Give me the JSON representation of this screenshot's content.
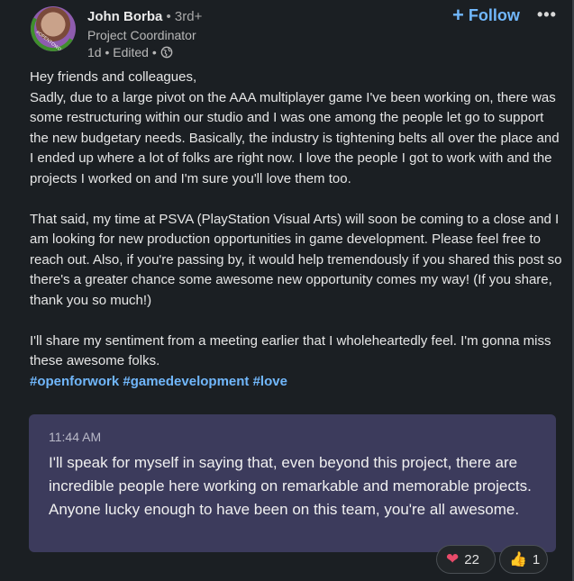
{
  "author": {
    "name": "John Borba",
    "degree": "• 3rd+",
    "headline": "Project Coordinator",
    "meta": "1d • Edited •",
    "avatar_badge": "#OPENTOWORK"
  },
  "actions": {
    "follow_label": "Follow",
    "more_icon": "•••"
  },
  "post": {
    "paragraph1": "Hey friends and colleagues,\nSadly, due to a large pivot on the AAA multiplayer game I've been working on, there was some restructuring within our studio and I was one among the people let go to support the new budgetary needs. Basically, the industry is tightening belts all over the place and I ended up where a lot of folks are right now. I love the people I got to work with and the projects I worked on and I'm sure you'll love them too.",
    "paragraph2": "That said, my time at PSVA (PlayStation Visual Arts) will soon be coming to a close and I am looking for new production opportunities in game development. Please feel free to reach out. Also, if you're passing by, it would help tremendously if you shared this post so there's a greater chance some awesome new opportunity comes my way! (If you share, thank you so much!)",
    "paragraph3": "I'll share my sentiment from a meeting earlier that I wholeheartedly feel. I'm gonna miss these awesome folks.",
    "hashtags": [
      "#openforwork",
      "#gamedevelopment",
      "#love"
    ]
  },
  "quote": {
    "time": "11:44 AM",
    "text": "I'll speak for myself in saying that, even beyond this project, there are incredible people here working on remarkable and memorable projects. Anyone lucky enough to have been on this team, you're all awesome."
  },
  "reactions": {
    "love_count": "22",
    "like_count": "1"
  },
  "colors": {
    "background": "#1b1f23",
    "accent": "#71b7fb",
    "quote_bg": "#3c3b5c",
    "open_to_work_green": "#3f8f2c"
  }
}
